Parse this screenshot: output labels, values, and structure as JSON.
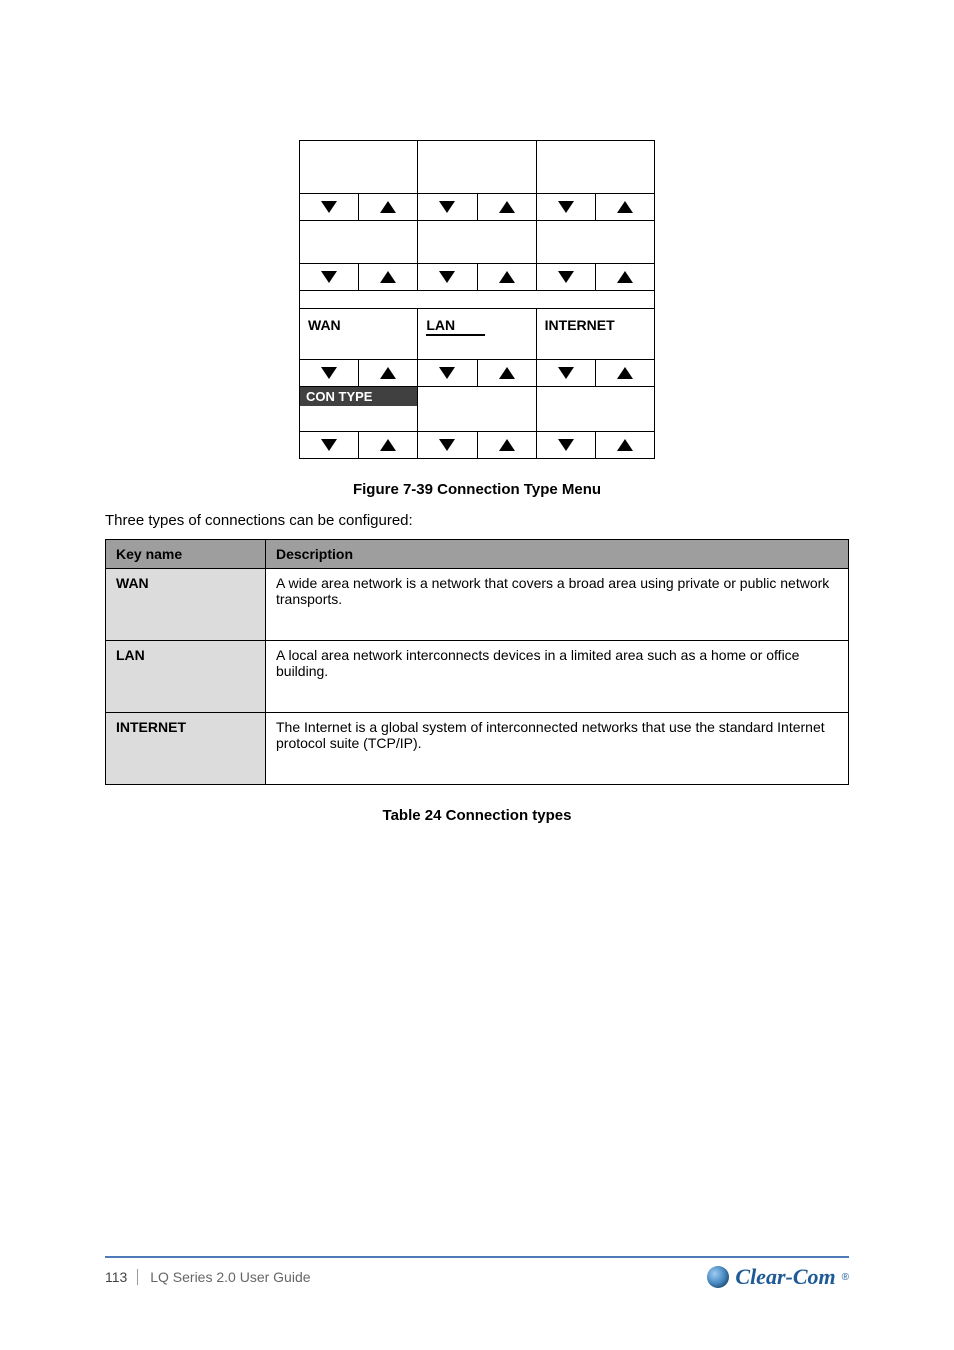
{
  "panel": {
    "row3": {
      "c1": "WAN",
      "c2": "LAN",
      "c3": "INTERNET"
    },
    "row4": {
      "dark": "CON TYPE"
    }
  },
  "caption": "Figure 7-39 Connection Type Menu",
  "lead": "Three types of connections can be configured:",
  "types": {
    "header_key": "Key name",
    "header_desc": "Description",
    "rows": [
      {
        "k": "WAN",
        "d": "A wide area network is a network that covers a broad area using private or public network transports."
      },
      {
        "k": "LAN",
        "d": "A local area network interconnects devices in a limited area such as a home or office building."
      },
      {
        "k": "INTERNET",
        "d": "The Internet is a global system of interconnected networks that use the standard Internet protocol suite (TCP/IP)."
      }
    ]
  },
  "table_caption": "Table 24 Connection types",
  "footer": {
    "page": "113",
    "doc": "LQ Series 2.0 User Guide",
    "brand": "Clear-Com"
  }
}
